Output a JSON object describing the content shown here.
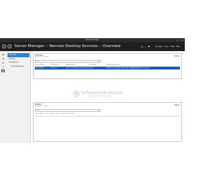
{
  "window": {
    "title": "Server Manager",
    "controls": [
      "–",
      "□",
      "✕"
    ]
  },
  "navbar": {
    "breadcrumb": [
      "Server Manager",
      "Remote Desktop Services",
      "Overview"
    ],
    "separator": "›",
    "menu": [
      "Manage",
      "Tools",
      "View",
      "Help"
    ]
  },
  "leftnav": {
    "icons": [
      "dashboard-icon",
      "local-server-icon",
      "all-servers-icon",
      "file-storage-icon",
      "rds-icon"
    ],
    "items": [
      {
        "label": "Overview",
        "selected": true
      },
      {
        "label": "Servers",
        "selected": false
      },
      {
        "label": "Collections",
        "selected": false
      },
      {
        "label": "QuickSessionCo...",
        "selected": false,
        "sub": true
      }
    ]
  },
  "servers_panel": {
    "title": "SERVERS",
    "subtitle": "All servers | 1 total",
    "tasks": "TASKS ▾",
    "filter_placeholder": "Filter",
    "columns": [
      "Server Name",
      "IPv4 Address",
      "Manageability",
      "Last Update",
      "Windows Activation"
    ],
    "rows": [
      {
        "cells": [
          "RDS-SRV-001",
          "10.0.0.11",
          "Online - Performance counters not started",
          "9/18/2017 5:34:01 AM",
          "00376-50511-54485-AA796 (Not activated)"
        ],
        "selected": true
      }
    ]
  },
  "watermark": {
    "brand": "Softwareindustrie24",
    "tagline": "DEINE SOFTWARE"
  },
  "events_panel": {
    "title": "EVENTS",
    "subtitle": "All events | 0 total",
    "tasks": "TASKS ▾",
    "filter_placeholder": "Filter",
    "columns": [
      "Server Name",
      "ID",
      "Severity",
      "Source",
      "Log",
      "Date and Time"
    ]
  },
  "colors": {
    "titlebar": "#2c2c2c",
    "navbar": "#1e1e1e",
    "selected_row": "#1060c0",
    "selected_nav": "#2f7fd0"
  }
}
